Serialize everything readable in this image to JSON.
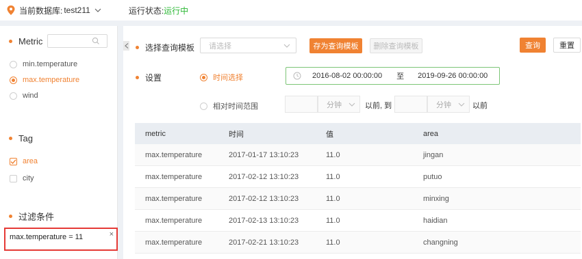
{
  "topbar": {
    "db_label": "当前数据库:",
    "db_value": "test211",
    "status_label": "运行状态:",
    "status_value": "运行中"
  },
  "sidebar": {
    "metric": {
      "title": "Metric",
      "search_placeholder": "",
      "items": [
        {
          "label": "min.temperature",
          "selected": false
        },
        {
          "label": "max.temperature",
          "selected": true
        },
        {
          "label": "wind",
          "selected": false
        }
      ]
    },
    "tag": {
      "title": "Tag",
      "items": [
        {
          "label": "area",
          "checked": true
        },
        {
          "label": "city",
          "checked": false
        }
      ]
    },
    "filter": {
      "title": "过滤条件",
      "condition": "max.temperature = 11",
      "close": "×"
    }
  },
  "query": {
    "template_label": "选择查询模板",
    "template_placeholder": "请选择",
    "save_template": "存为查询模板",
    "delete_template": "删除查询模板",
    "query_button": "查询",
    "reset_button": "重置"
  },
  "settings": {
    "label": "设置",
    "time_select": "时间选择",
    "start": "2016-08-02 00:00:00",
    "to": "至",
    "end": "2019-09-26 00:00:00",
    "relative_range": "相对时间范围",
    "unit1": "分钟",
    "before_to": "以前, 到",
    "unit2": "分钟",
    "before": "以前"
  },
  "table": {
    "headers": [
      "metric",
      "时间",
      "值",
      "area"
    ],
    "rows": [
      [
        "max.temperature",
        "2017-01-17 13:10:23",
        "11.0",
        "jingan"
      ],
      [
        "max.temperature",
        "2017-02-12 13:10:23",
        "11.0",
        "putuo"
      ],
      [
        "max.temperature",
        "2017-02-12 13:10:23",
        "11.0",
        "minxing"
      ],
      [
        "max.temperature",
        "2017-02-13 13:10:23",
        "11.0",
        "haidian"
      ],
      [
        "max.temperature",
        "2017-02-21 13:10:23",
        "11.0",
        "changning"
      ]
    ]
  },
  "colors": {
    "accent": "#f08232",
    "running": "#2db836",
    "filter_border": "#e53935"
  }
}
